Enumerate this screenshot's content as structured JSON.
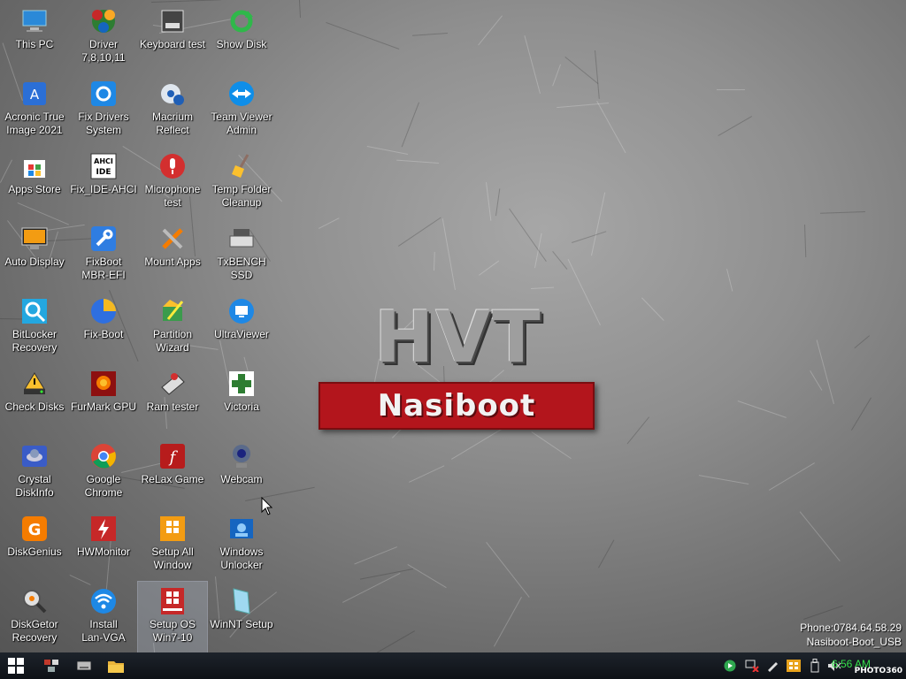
{
  "desktop_icons": [
    {
      "label": "This PC",
      "icon": "computer-icon"
    },
    {
      "label": "Driver\n7,8,10,11",
      "icon": "driver-pack-icon"
    },
    {
      "label": "Keyboard test",
      "icon": "keyboard-test-icon"
    },
    {
      "label": "Show Disk",
      "icon": "refresh-icon"
    },
    {
      "label": "Acronic True\nImage 2021",
      "icon": "acronis-icon"
    },
    {
      "label": "Fix Drivers\nSystem",
      "icon": "fix-drivers-icon"
    },
    {
      "label": "Macrium\nReflect",
      "icon": "macrium-icon"
    },
    {
      "label": "Team Viewer\nAdmin",
      "icon": "teamviewer-icon"
    },
    {
      "label": "Apps Store",
      "icon": "store-icon"
    },
    {
      "label": "Fix_IDE-AHCI",
      "icon": "ahci-icon"
    },
    {
      "label": "Microphone\ntest",
      "icon": "microphone-icon"
    },
    {
      "label": "Temp Folder\nCleanup",
      "icon": "broom-icon"
    },
    {
      "label": "Auto Display",
      "icon": "display-icon"
    },
    {
      "label": "FixBoot\nMBR-EFI",
      "icon": "wrench-icon"
    },
    {
      "label": "Mount Apps",
      "icon": "tools-icon"
    },
    {
      "label": "TxBENCH SSD",
      "icon": "ssd-icon"
    },
    {
      "label": "BitLocker\nRecovery",
      "icon": "bitlocker-icon"
    },
    {
      "label": "Fix-Boot",
      "icon": "pie-icon"
    },
    {
      "label": "Partition\nWizard",
      "icon": "partition-icon"
    },
    {
      "label": "UltraViewer",
      "icon": "ultraviewer-icon"
    },
    {
      "label": "Check Disks",
      "icon": "warning-disk-icon"
    },
    {
      "label": "FurMark GPU",
      "icon": "furmark-icon"
    },
    {
      "label": "Ram tester",
      "icon": "ram-icon"
    },
    {
      "label": "Victoria",
      "icon": "cross-icon"
    },
    {
      "label": "Crystal\nDiskInfo",
      "icon": "crystal-icon"
    },
    {
      "label": "Google\nChrome",
      "icon": "chrome-icon"
    },
    {
      "label": "ReLax Game",
      "icon": "flash-icon"
    },
    {
      "label": "Webcam",
      "icon": "webcam-icon"
    },
    {
      "label": "DiskGenius",
      "icon": "diskgenius-icon"
    },
    {
      "label": "HWMonitor",
      "icon": "hwmonitor-icon"
    },
    {
      "label": "Setup All\nWindow",
      "icon": "windows10-box-icon"
    },
    {
      "label": "Windows\nUnlocker",
      "icon": "unlocker-icon"
    },
    {
      "label": "DiskGetor\nRecovery",
      "icon": "diskgetor-icon"
    },
    {
      "label": "Install\nLan-VGA",
      "icon": "wifi-icon"
    },
    {
      "label": "Setup OS\nWin7-10",
      "icon": "windows81-box-icon"
    },
    {
      "label": "WinNT Setup",
      "icon": "winnt-icon"
    }
  ],
  "wallpaper": {
    "logo_top": "HVT",
    "logo_band": "Nasiboot"
  },
  "info": {
    "phone": "Phone:0784.64.58.29",
    "name": "Nasiboot-Boot_USB"
  },
  "taskbar": {
    "clock": "6:56 AM",
    "brand": "PHOTO360"
  },
  "colors": {
    "taskbar": "#12161c",
    "band": "#b3151c",
    "clock": "#35e04a"
  }
}
